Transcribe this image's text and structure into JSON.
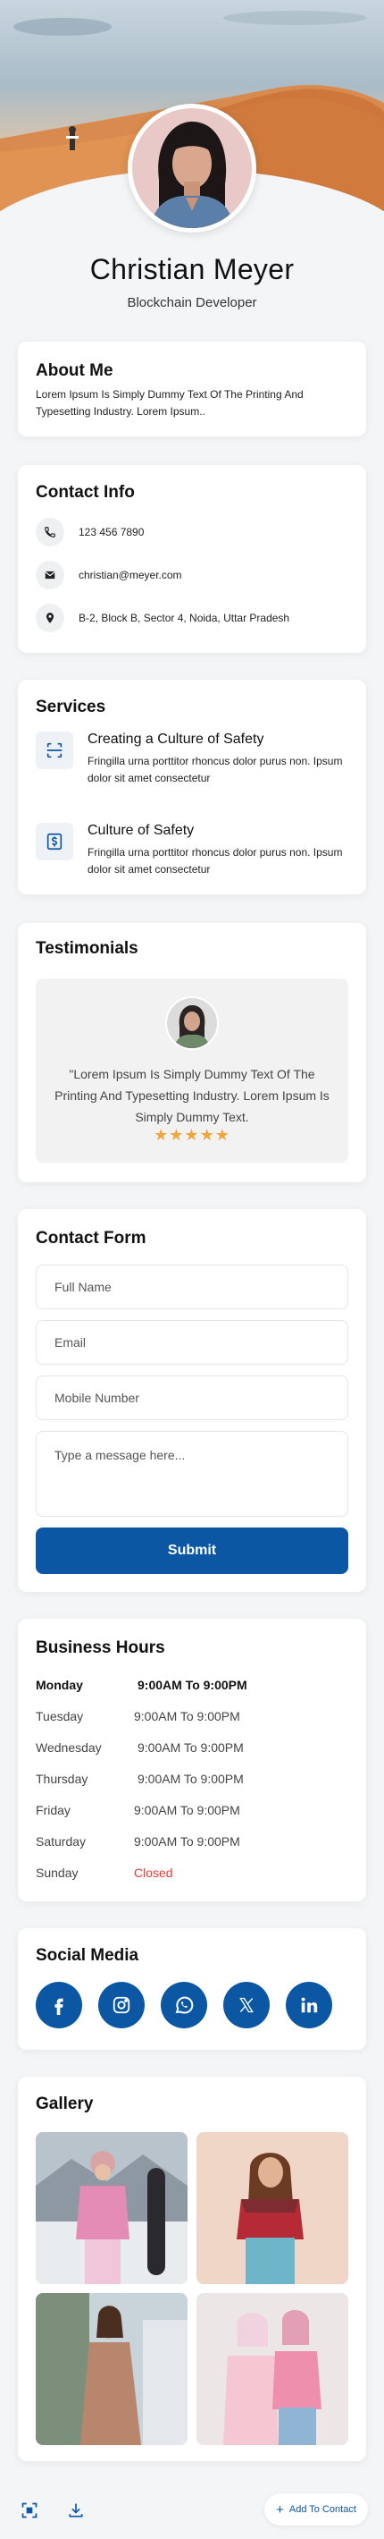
{
  "profile": {
    "name": "Christian Meyer",
    "role": "Blockchain Developer"
  },
  "about": {
    "title": "About Me",
    "text": "Lorem Ipsum Is Simply Dummy Text Of The Printing And Typesetting Industry. Lorem Ipsum.."
  },
  "contact_info": {
    "title": "Contact Info",
    "items": [
      {
        "icon": "phone-icon",
        "text": "123 456 7890"
      },
      {
        "icon": "mail-icon",
        "text": "christian@meyer.com"
      },
      {
        "icon": "location-pin-icon",
        "text": "B-2, Block B, Sector 4, Noida, Uttar Pradesh"
      }
    ]
  },
  "services": {
    "title": "Services",
    "items": [
      {
        "icon": "scan-icon",
        "title": "Creating a Culture of Safety",
        "desc": "Fringilla urna porttitor rhoncus dolor purus non. Ipsum dolor sit amet consectetur"
      },
      {
        "icon": "dollar-icon",
        "title": "Culture of Safety",
        "desc": "Fringilla urna porttitor rhoncus dolor purus non. Ipsum dolor sit amet consectetur"
      }
    ]
  },
  "testimonials": {
    "title": "Testimonials",
    "quote": "\"Lorem Ipsum Is Simply Dummy Text Of The Printing And Typesetting Industry. Lorem Ipsum Is Simply Dummy Text.",
    "stars": "★★★★★",
    "rating": 5
  },
  "contact_form": {
    "title": "Contact Form",
    "name_placeholder": "Full Name",
    "email_placeholder": "Email",
    "mobile_placeholder": "Mobile Number",
    "message_placeholder": "Type a message here...",
    "submit_label": "Submit"
  },
  "business_hours": {
    "title": "Business Hours",
    "rows": [
      {
        "day": "Monday",
        "time": "9:00AM To 9:00PM"
      },
      {
        "day": "Tuesday",
        "time": "9:00AM To 9:00PM"
      },
      {
        "day": "Wednesday",
        "time": "9:00AM To 9:00PM"
      },
      {
        "day": "Thursday",
        "time": "9:00AM To 9:00PM"
      },
      {
        "day": "Friday",
        "time": "9:00AM To 9:00PM"
      },
      {
        "day": "Saturday",
        "time": "9:00AM To 9:00PM"
      },
      {
        "day": "Sunday",
        "time": "Closed"
      }
    ]
  },
  "social": {
    "title": "Social Media",
    "items": [
      "facebook-icon",
      "instagram-icon",
      "whatsapp-icon",
      "x-icon",
      "linkedin-icon"
    ]
  },
  "gallery": {
    "title": "Gallery"
  },
  "bottom_bar": {
    "add_contact_label": "Add To Contact"
  },
  "colors": {
    "primary": "#0b57a4",
    "closed": "#e53935",
    "stars": "#f0a63c"
  }
}
